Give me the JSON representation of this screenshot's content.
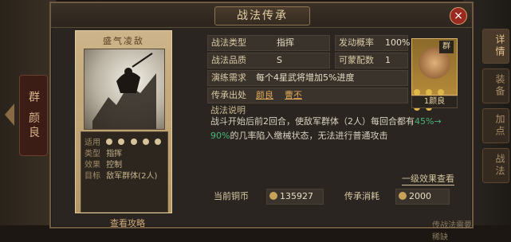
{
  "modal": {
    "title": "战法传承",
    "close": "×"
  },
  "left_side": {
    "tab": "群 颜良"
  },
  "right_tabs": [
    "详情",
    "装备",
    "加点",
    "战法"
  ],
  "card": {
    "title": "盛气凌敌",
    "info": {
      "usable_label": "适用",
      "type_label": "类型",
      "type_value": "指挥",
      "effect_label": "效果",
      "effect_value": "控制",
      "target_label": "目标",
      "target_value": "敌军群体(2人)"
    }
  },
  "details": {
    "tactic_type_label": "战法类型",
    "tactic_type_value": "指挥",
    "trigger_rate_label": "发动概率",
    "trigger_rate_value": "100%",
    "quality_label": "战法品质",
    "quality_value": "S",
    "slots_label": "可蒙配数",
    "slots_value": "1",
    "practice_label": "演练需求",
    "practice_value": "每个4星武将增加5%进度",
    "source_label": "传承出处",
    "source_values": [
      "颜良",
      "曹丕"
    ],
    "description_label": "战法说明",
    "description_part1": "战斗开始后前2回合，使敌军群体（2人）每回合都有",
    "description_highlight1": "45%→",
    "description_highlight2": "90%",
    "description_part2": "的几率陷入缴械状态，无法进行普通攻击"
  },
  "level_link": "一级效果查看",
  "currency": {
    "current_label": "当前铜币",
    "current_value": "135927",
    "cost_label": "传承消耗",
    "cost_value": "2000"
  },
  "bottom": {
    "guide_link": "查看攻略",
    "hint": "传战法需要稀缺"
  },
  "hero": {
    "faction": "群",
    "level_name": "1颜良"
  }
}
